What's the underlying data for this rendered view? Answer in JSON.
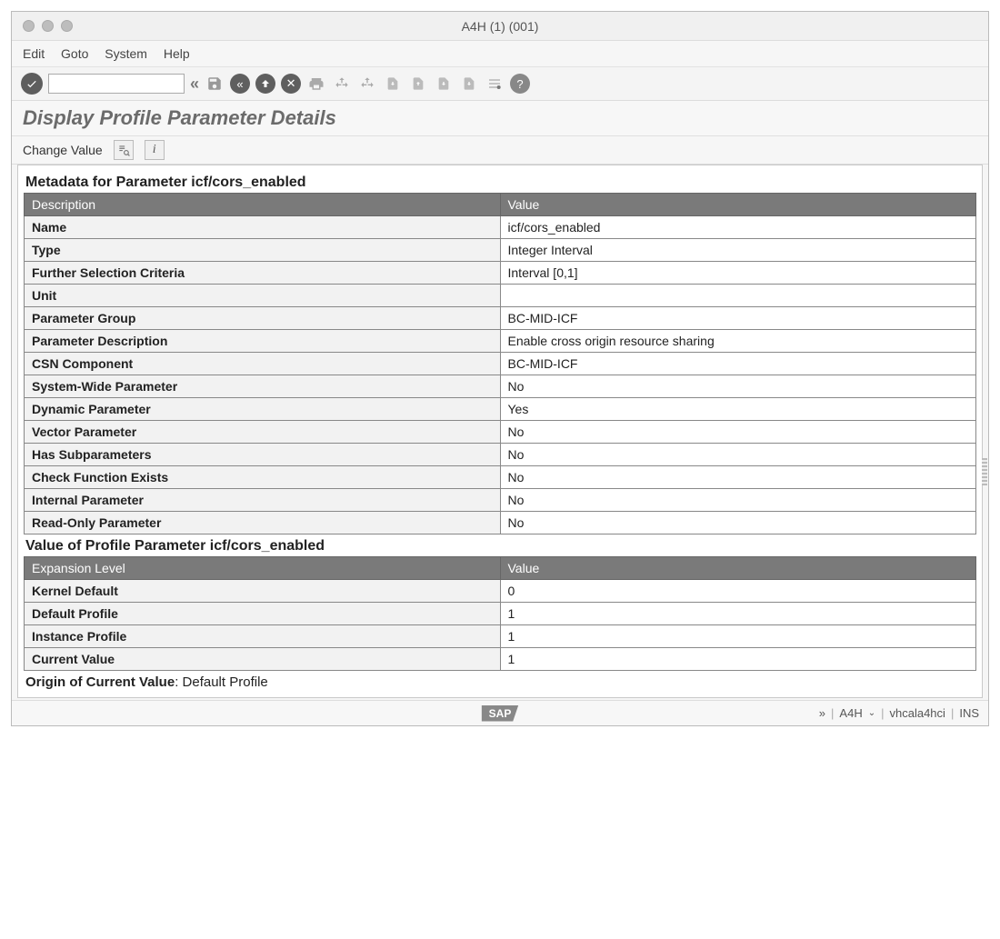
{
  "window": {
    "title": "A4H (1) (001)"
  },
  "menu": [
    "Edit",
    "Goto",
    "System",
    "Help"
  ],
  "page_title": "Display Profile Parameter Details",
  "subtoolbar": {
    "change_value": "Change Value"
  },
  "section1": {
    "title": "Metadata for Parameter icf/cors_enabled",
    "col1": "Description",
    "col2": "Value",
    "rows": [
      {
        "label": "Name",
        "value": "icf/cors_enabled"
      },
      {
        "label": "Type",
        "value": "Integer Interval"
      },
      {
        "label": "Further Selection Criteria",
        "value": "Interval [0,1]"
      },
      {
        "label": "Unit",
        "value": ""
      },
      {
        "label": "Parameter Group",
        "value": "BC-MID-ICF"
      },
      {
        "label": "Parameter Description",
        "value": "Enable cross origin resource sharing"
      },
      {
        "label": "CSN Component",
        "value": "BC-MID-ICF"
      },
      {
        "label": "System-Wide Parameter",
        "value": "No"
      },
      {
        "label": "Dynamic Parameter",
        "value": "Yes"
      },
      {
        "label": "Vector Parameter",
        "value": "No"
      },
      {
        "label": "Has Subparameters",
        "value": "No"
      },
      {
        "label": "Check Function Exists",
        "value": "No"
      },
      {
        "label": "Internal Parameter",
        "value": "No"
      },
      {
        "label": "Read-Only Parameter",
        "value": "No"
      }
    ]
  },
  "section2": {
    "title": "Value of Profile Parameter icf/cors_enabled",
    "col1": "Expansion Level",
    "col2": "Value",
    "rows": [
      {
        "label": "Kernel Default",
        "value": "0"
      },
      {
        "label": "Default Profile",
        "value": "1"
      },
      {
        "label": "Instance Profile",
        "value": "1"
      },
      {
        "label": "Current Value",
        "value": "1"
      }
    ]
  },
  "origin": {
    "label": "Origin of Current Value",
    "value": "Default Profile"
  },
  "status": {
    "system": "A4H",
    "host": "vhcala4hci",
    "mode": "INS",
    "expand": "»"
  }
}
